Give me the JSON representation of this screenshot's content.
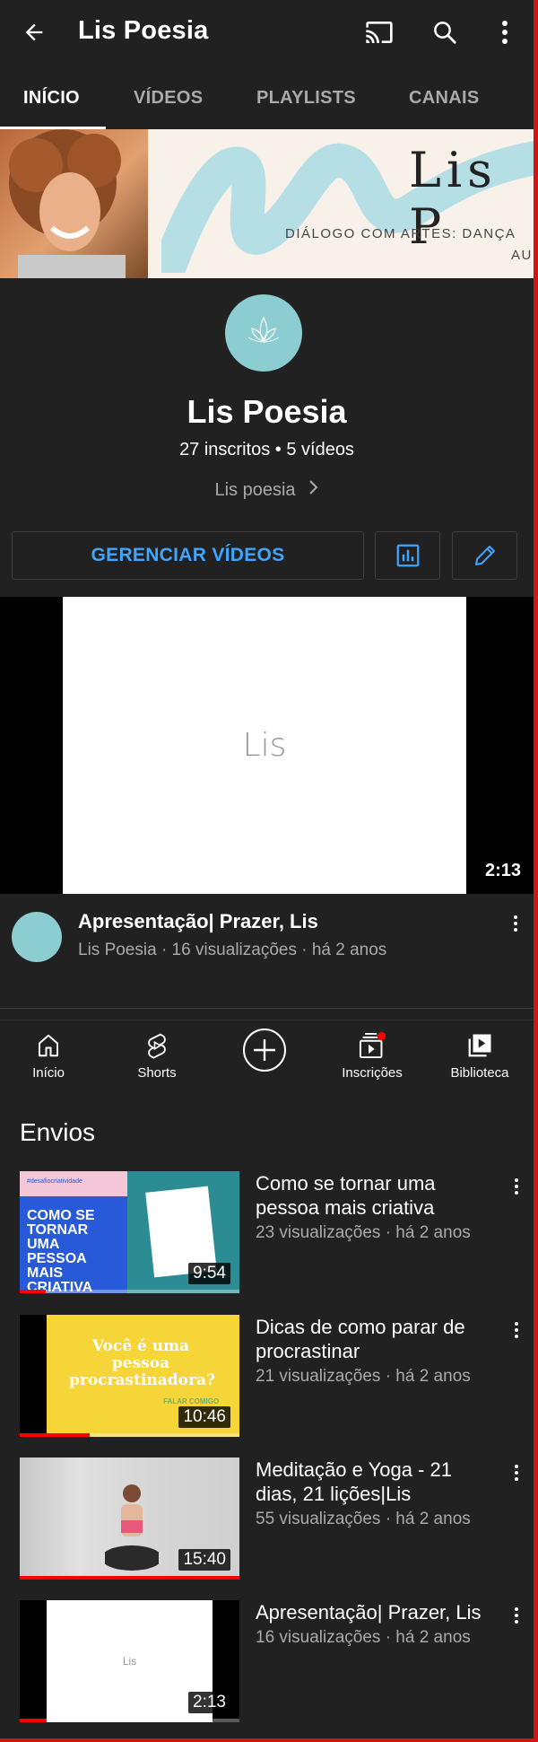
{
  "header": {
    "title": "Lis Poesia",
    "back_icon": "arrow-left-icon",
    "cast_icon": "cast-icon",
    "search_icon": "search-icon",
    "more_icon": "more-vert-icon"
  },
  "tabs": [
    {
      "label": "INÍCIO",
      "active": true
    },
    {
      "label": "VÍDEOS",
      "active": false
    },
    {
      "label": "PLAYLISTS",
      "active": false
    },
    {
      "label": "CANAIS",
      "active": false
    }
  ],
  "banner": {
    "name": "Lis P",
    "tagline": "DIÁLOGO COM ARTES: DANÇA",
    "tagline2": "AU"
  },
  "channel": {
    "name": "Lis Poesia",
    "stats": "27 inscritos • 5 vídeos",
    "link": "Lis poesia",
    "avatar_text": "Lis Poesia"
  },
  "actions": {
    "manage": "GERENCIAR VÍDEOS",
    "analytics_icon": "bar-chart-icon",
    "edit_icon": "pencil-icon"
  },
  "featured": {
    "thumb_text": "Lis",
    "duration": "2:13",
    "title": "Apresentação| Prazer, Lis",
    "meta": "Lis Poesia · 16 visualizações · há 2 anos"
  },
  "bottom_nav": [
    {
      "label": "Início",
      "icon": "home-icon"
    },
    {
      "label": "Shorts",
      "icon": "shorts-icon"
    },
    {
      "label": "",
      "icon": "create-plus-icon"
    },
    {
      "label": "Inscrições",
      "icon": "subscriptions-icon"
    },
    {
      "label": "Biblioteca",
      "icon": "library-icon"
    }
  ],
  "uploads": {
    "title": "Envios",
    "items": [
      {
        "title": "Como se tornar uma pessoa mais criativa",
        "meta": "23 visualizações · há 2 anos",
        "duration": "9:54",
        "thumb_text": "COMO SE TORNAR UMA PESSOA MAIS CRIATIVA",
        "thumb_small": "#desafiocriatividade",
        "progress": 0.12
      },
      {
        "title": "Dicas de como parar de procrastinar",
        "meta": "21 visualizações · há 2 anos",
        "duration": "10:46",
        "thumb_text": "Você é uma pessoa procrastinadora?",
        "thumb_small": "FALAR COMIGO",
        "progress": 0.32
      },
      {
        "title": "Meditação e Yoga - 21 dias, 21 lições|Lis",
        "meta": "55 visualizações · há 2 anos",
        "duration": "15:40",
        "progress": 1.0
      },
      {
        "title": "Apresentação| Prazer, Lis",
        "meta": "16 visualizações · há 2 anos",
        "duration": "2:13",
        "thumb_text": "Lis",
        "progress": 0.12
      }
    ]
  }
}
